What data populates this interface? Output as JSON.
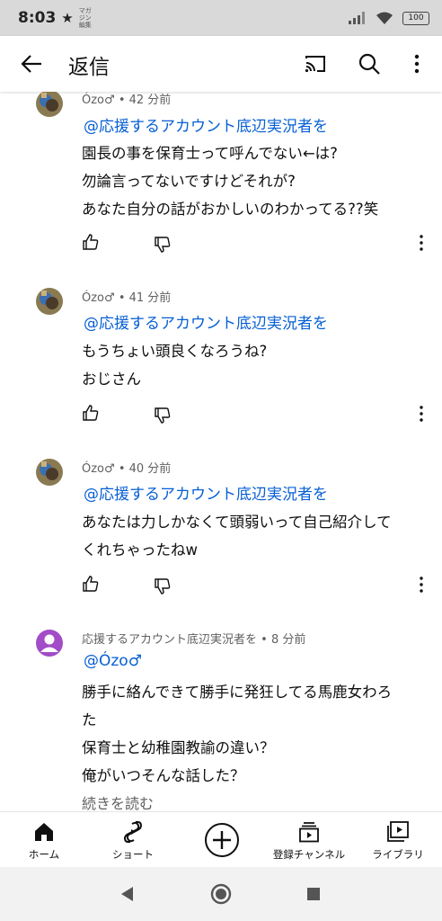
{
  "status": {
    "time": "8:03",
    "small_text": "マガジン 編集",
    "battery": "100"
  },
  "appbar": {
    "title": "返信"
  },
  "comments": [
    {
      "author": "Ózo♂",
      "time": "42 分前",
      "mention": "@応援するアカウント底辺実況者を",
      "lines": [
        "園長の事を保育士って呼んでない←は?",
        "勿論言ってないですけどそれが?",
        "あなた自分の話がおかしいのわかってる??笑"
      ]
    },
    {
      "author": "Ózo♂",
      "time": "41 分前",
      "mention": "@応援するアカウント底辺実況者を",
      "lines": [
        "もうちょい頭良くなろうね?",
        "おじさん"
      ]
    },
    {
      "author": "Ózo♂",
      "time": "40 分前",
      "mention": "@応援するアカウント底辺実況者を",
      "lines": [
        "あなたは力しかなくて頭弱いって自己紹介して",
        "くれちゃったねw"
      ]
    },
    {
      "author": "応援するアカウント底辺実況者を",
      "time": "8 分前",
      "mention": "@Ózo♂",
      "lines": [
        "勝手に絡んできて勝手に発狂してる馬鹿女わろ",
        "た",
        "保育士と幼稚園教諭の違い？",
        "俺がいつそんな話した？"
      ],
      "read_more": "続きを読む"
    }
  ],
  "separator": "•",
  "nav": {
    "home": "ホーム",
    "shorts": "ショート",
    "subscriptions": "登録チャンネル",
    "library": "ライブラリ"
  },
  "colors": {
    "link": "#065fd4",
    "meta": "#606060",
    "avatar_purple": "#a24cc7"
  }
}
